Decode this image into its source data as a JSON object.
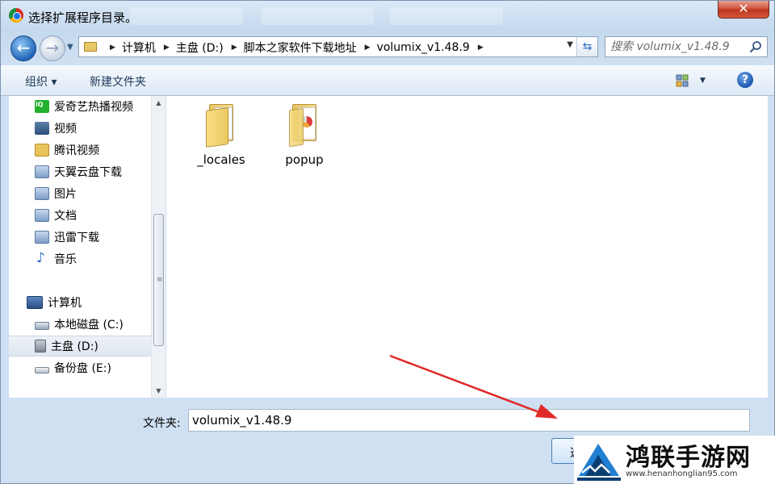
{
  "window": {
    "title": "选择扩展程序目录。",
    "close_label": "✕"
  },
  "address": {
    "crumbs": [
      "计算机",
      "主盘 (D:)",
      "脚本之家软件下载地址",
      "volumix_v1.48.9"
    ],
    "search_placeholder": "搜索 volumix_v1.48.9"
  },
  "toolbar": {
    "organize_label": "组织 ▾",
    "new_folder_label": "新建文件夹",
    "help_label": "?"
  },
  "sidebar": {
    "items": [
      {
        "label": "爱奇艺热播视频",
        "icon": "iqiyi-icon"
      },
      {
        "label": "视频",
        "icon": "video-library-icon"
      },
      {
        "label": "腾讯视频",
        "icon": "folder-icon"
      },
      {
        "label": "天翼云盘下载",
        "icon": "library-icon"
      },
      {
        "label": "图片",
        "icon": "pictures-library-icon"
      },
      {
        "label": "文档",
        "icon": "documents-library-icon"
      },
      {
        "label": "迅雷下载",
        "icon": "library-icon"
      },
      {
        "label": "音乐",
        "icon": "music-icon"
      },
      {
        "label": "计算机",
        "icon": "computer-icon"
      },
      {
        "label": "本地磁盘 (C:)",
        "icon": "drive-icon"
      },
      {
        "label": "主盘 (D:)",
        "icon": "usb-drive-icon",
        "selected": true
      },
      {
        "label": "备份盘 (E:)",
        "icon": "external-drive-icon"
      }
    ]
  },
  "files": [
    {
      "name": "_locales",
      "icon": "folder-icon"
    },
    {
      "name": "popup",
      "icon": "folder-with-file-icon"
    }
  ],
  "bottom": {
    "folder_label": "文件夹:",
    "folder_value": "volumix_v1.48.9",
    "select_label": "选"
  },
  "watermark": {
    "title": "鸿联手游网",
    "url": "www.henanhonglian95.com"
  },
  "colors": {
    "accent": "#2266b8",
    "arrow": "#e02a2a",
    "close": "#cf4b33"
  }
}
